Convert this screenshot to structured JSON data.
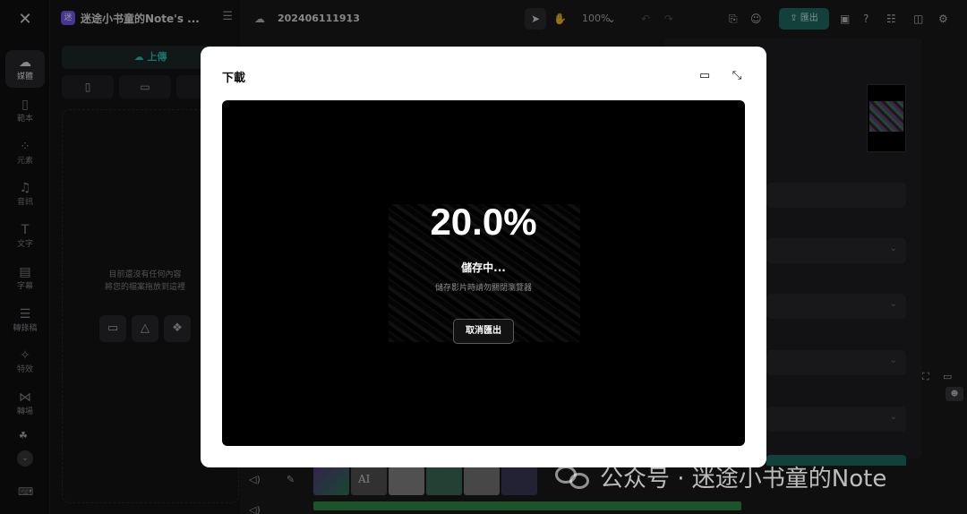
{
  "rail": {
    "items": [
      {
        "label": "媒體",
        "icon": "cloud-icon"
      },
      {
        "label": "範本",
        "icon": "template-icon"
      },
      {
        "label": "元素",
        "icon": "elements-icon"
      },
      {
        "label": "音訊",
        "icon": "music-icon"
      },
      {
        "label": "文字",
        "icon": "text-icon"
      },
      {
        "label": "字幕",
        "icon": "subtitle-icon"
      },
      {
        "label": "轉錄稿",
        "icon": "transcript-icon"
      },
      {
        "label": "特效",
        "icon": "effects-icon"
      },
      {
        "label": "轉場",
        "icon": "transition-icon"
      }
    ]
  },
  "panel": {
    "project_title": "迷途小书童的Note's ...",
    "upload_label": "上傳",
    "empty_line1": "目前還沒有任何內容",
    "empty_line2": "將您的檔案拖放到這裡"
  },
  "topbar": {
    "project_name": "202406111913",
    "zoom": "100%",
    "export_label": "匯出"
  },
  "modal": {
    "title": "下載",
    "progress_percent": "20.0%",
    "status": "儲存中...",
    "hint": "儲存影片時請勿關閉瀏覽器",
    "cancel_label": "取消匯出"
  },
  "timeline": {
    "clip_text": "AI"
  },
  "watermark": {
    "text": "公众号 · 迷途小书童的Note"
  },
  "colors": {
    "accent": "#1f6f66",
    "modal_bg": "#ffffff",
    "video_bg": "#000000"
  }
}
